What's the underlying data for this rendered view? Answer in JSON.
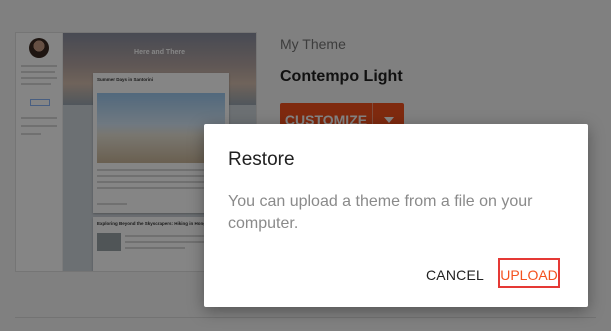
{
  "preview": {
    "blog_title": "Here and There",
    "post1_title": "Summer Days in Santorini",
    "post2_title": "Exploring Beyond the Skyscrapers: Hiking in Hong Kong"
  },
  "theme": {
    "section_label": "My Theme",
    "name": "Contempo Light",
    "customize_label": "CUSTOMIZE"
  },
  "dialog": {
    "title": "Restore",
    "body": "You can upload a theme from a file on your computer.",
    "cancel_label": "CANCEL",
    "upload_label": "UPLOAD"
  },
  "colors": {
    "accent": "#f4511e",
    "highlight_border": "#e53935"
  }
}
